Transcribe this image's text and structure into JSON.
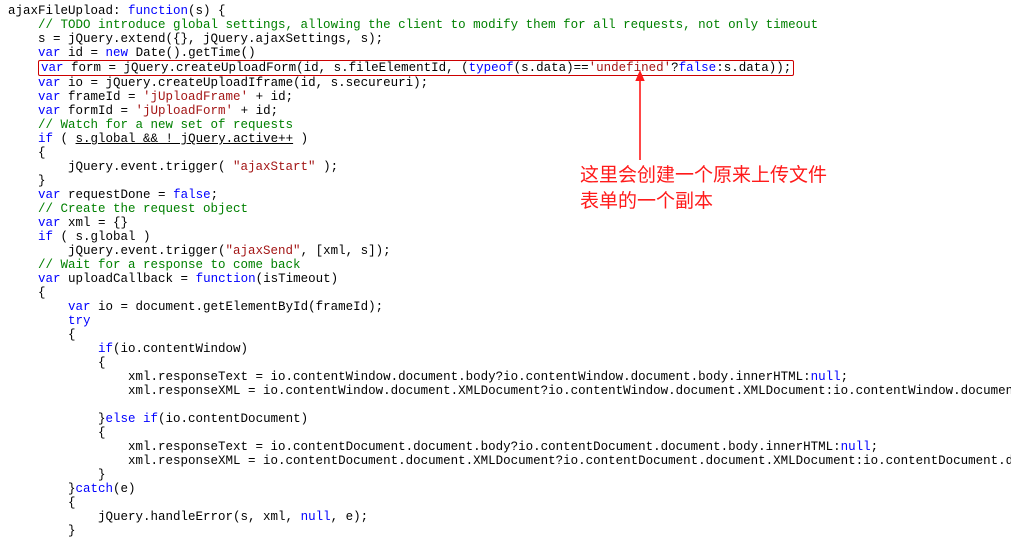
{
  "annotation": {
    "line1": "这里会创建一个原来上传文件",
    "line2": "表单的一个副本"
  },
  "code": {
    "l01a": "ajaxFileUpload: ",
    "l01b": "function",
    "l01c": "(s) {",
    "l02": "// TODO introduce global settings, allowing the client to modify them for all requests, not only timeout",
    "l03": "s = jQuery.extend({}, jQuery.ajaxSettings, s);",
    "l04a": "var",
    "l04b": " id = ",
    "l04c": "new",
    "l04d": " Date().getTime()",
    "l05a": "var",
    "l05b": " form = jQuery.createUploadForm(id, s.fileElementId, (",
    "l05c": "typeof",
    "l05d": "(s.data)==",
    "l05e": "'undefined'",
    "l05f": "?",
    "l05g": "false",
    "l05h": ":s.data));",
    "l06a": "var",
    "l06b": " io = jQuery.createUploadIframe(id, s.secureuri);",
    "l07a": "var",
    "l07b": " frameId = ",
    "l07c": "'jUploadFrame'",
    "l07d": " + id;",
    "l08a": "var",
    "l08b": " formId = ",
    "l08c": "'jUploadForm'",
    "l08d": " + id;",
    "l09": "// Watch for a new set of requests",
    "l10a": "if",
    "l10b": " ( ",
    "l10c": "s.global && ! jQuery.active++",
    "l10d": " )",
    "l11": "{",
    "l12a": "jQuery.event.trigger( ",
    "l12b": "\"ajaxStart\"",
    "l12c": " );",
    "l13": "}",
    "l14a": "var",
    "l14b": " requestDone = ",
    "l14c": "false",
    "l14d": ";",
    "l15": "// Create the request object",
    "l16a": "var",
    "l16b": " xml = {}",
    "l17a": "if",
    "l17b": " ( s.global )",
    "l18a": "jQuery.event.trigger(",
    "l18b": "\"ajaxSend\"",
    "l18c": ", [xml, s]);",
    "l19": "// Wait for a response to come back",
    "l20a": "var",
    "l20b": " uploadCallback = ",
    "l20c": "function",
    "l20d": "(isTimeout)",
    "l21": "{",
    "l22a": "var",
    "l22b": " io = document.getElementById(frameId);",
    "l23": "try",
    "l24": "{",
    "l25a": "if",
    "l25b": "(io.contentWindow)",
    "l26": "{",
    "l27a": "xml.responseText = io.contentWindow.document.body?io.contentWindow.document.body.innerHTML:",
    "l27b": "null",
    "l27c": ";",
    "l28": "xml.responseXML = io.contentWindow.document.XMLDocument?io.contentWindow.document.XMLDocument:io.contentWindow.document;",
    "l29": "",
    "l30a": "}",
    "l30b": "else if",
    "l30c": "(io.contentDocument)",
    "l31": "{",
    "l32a": "xml.responseText = io.contentDocument.document.body?io.contentDocument.document.body.innerHTML:",
    "l32b": "null",
    "l32c": ";",
    "l33": "xml.responseXML = io.contentDocument.document.XMLDocument?io.contentDocument.document.XMLDocument:io.contentDocument.documen",
    "l34": "}",
    "l35a": "}",
    "l35b": "catch",
    "l35c": "(e)",
    "l36": "{",
    "l37a": "jQuery.handleError(s, xml, ",
    "l37b": "null",
    "l37c": ", e);",
    "l38": "}"
  }
}
